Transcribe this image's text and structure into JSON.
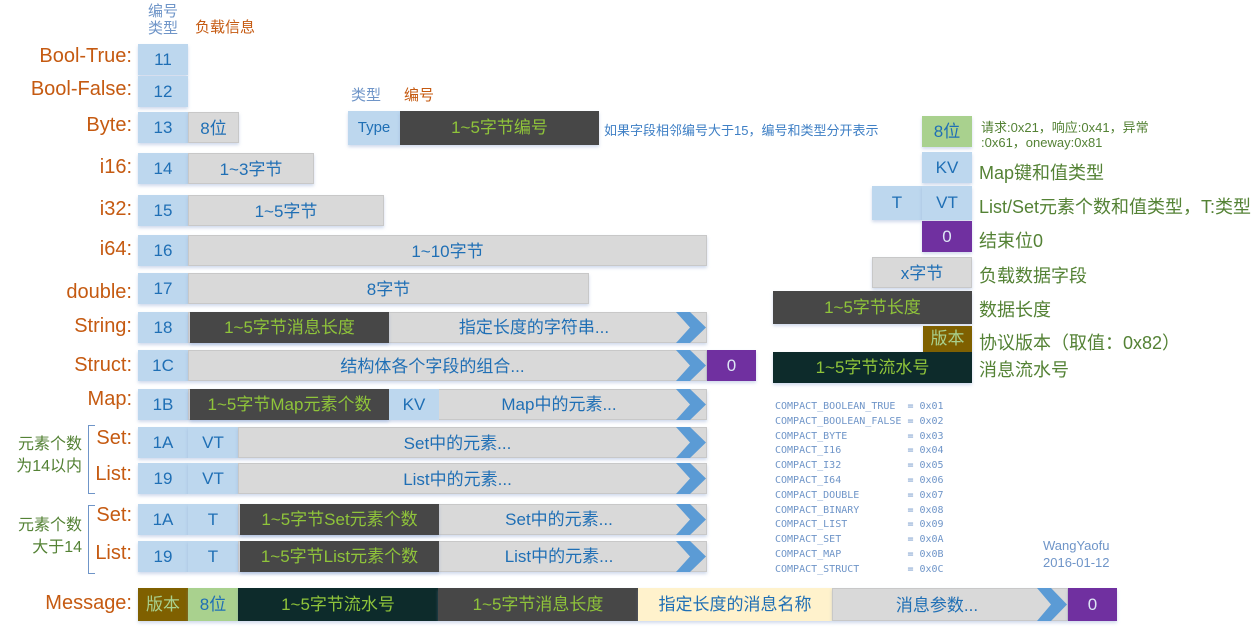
{
  "header": {
    "code_type": "编号\n类型",
    "code_type_l1": "编号",
    "code_type_l2": "类型",
    "payload": "负载信息"
  },
  "rows": [
    {
      "label": "Bool-True:",
      "code": "11"
    },
    {
      "label": "Bool-False:",
      "code": "12"
    },
    {
      "label": "Byte:",
      "code": "13",
      "payload": "8位"
    },
    {
      "label": "i16:",
      "code": "14",
      "payload": "1~3字节"
    },
    {
      "label": "i32:",
      "code": "15",
      "payload": "1~5字节"
    },
    {
      "label": "i64:",
      "code": "16",
      "payload": "1~10字节"
    },
    {
      "label": "double:",
      "code": "17",
      "payload": "8字节"
    },
    {
      "label": "String:",
      "code": "18",
      "len": "1~5字节消息长度",
      "payload": "指定长度的字符串..."
    },
    {
      "label": "Struct:",
      "code": "1C",
      "payload": "结构体各个字段的组合...",
      "end": "0"
    },
    {
      "label": "Map:",
      "code": "1B",
      "len": "1~5字节Map元素个数",
      "kv": "KV",
      "payload": "Map中的元素..."
    },
    {
      "label": "Set:",
      "code": "1A",
      "vt": "VT",
      "payload": "Set中的元素..."
    },
    {
      "label": "List:",
      "code": "19",
      "vt": "VT",
      "payload": "List中的元素..."
    },
    {
      "label": "Set:",
      "code": "1A",
      "t": "T",
      "len": "1~5字节Set元素个数",
      "payload": "Set中的元素..."
    },
    {
      "label": "List:",
      "code": "19",
      "t": "T",
      "len": "1~5字节List元素个数",
      "payload": "List中的元素..."
    }
  ],
  "groups": {
    "small_l1": "元素个数",
    "small_l2": "为14以内",
    "large_l1": "元素个数",
    "large_l2": "大于14"
  },
  "field_header": {
    "type_label": "类型",
    "id_label": "编号",
    "type_box": "Type",
    "id_box": "1~5字节编号",
    "note": "如果字段相邻编号大于15，编号和类型分开表示"
  },
  "legend": [
    {
      "box": "8位",
      "text_l1": "请求:0x21，响应:0x41，异常",
      "text_l2": ":0x61，oneway:0x81"
    },
    {
      "box": "KV",
      "text": "Map键和值类型"
    },
    {
      "box_t": "T",
      "box": "VT",
      "text": "List/Set元素个数和值类型，T:类型"
    },
    {
      "box": "0",
      "text": "结束位0"
    },
    {
      "box": "x字节",
      "text": "负载数据字段"
    },
    {
      "box": "1~5字节长度",
      "text": "数据长度"
    },
    {
      "box": "版本",
      "text": "协议版本（取值：0x82）"
    },
    {
      "box": "1~5字节流水号",
      "text": "消息流水号"
    }
  ],
  "constants": [
    {
      "name": "COMPACT_BOOLEAN_TRUE",
      "value": "0x01"
    },
    {
      "name": "COMPACT_BOOLEAN_FALSE",
      "value": "0x02"
    },
    {
      "name": "COMPACT_BYTE",
      "value": "0x03"
    },
    {
      "name": "COMPACT_I16",
      "value": "0x04"
    },
    {
      "name": "COMPACT_I32",
      "value": "0x05"
    },
    {
      "name": "COMPACT_I64",
      "value": "0x06"
    },
    {
      "name": "COMPACT_DOUBLE",
      "value": "0x07"
    },
    {
      "name": "COMPACT_BINARY",
      "value": "0x08"
    },
    {
      "name": "COMPACT_LIST",
      "value": "0x09"
    },
    {
      "name": "COMPACT_SET",
      "value": "0x0A"
    },
    {
      "name": "COMPACT_MAP",
      "value": "0x0B"
    },
    {
      "name": "COMPACT_STRUCT",
      "value": "0x0C"
    }
  ],
  "author": {
    "name": "WangYaofu",
    "date": "2016-01-12"
  },
  "message": {
    "label": "Message:",
    "version": "版本",
    "bits": "8位",
    "seq": "1~5字节流水号",
    "len": "1~5字节消息长度",
    "name": "指定长度的消息名称",
    "params": "消息参数...",
    "end": "0"
  },
  "colors": {
    "label": "#c55a11",
    "code_bg": "#bdd7ee",
    "payload_bg": "#d9d9d9",
    "dark_bg": "#474747",
    "teal_bg": "#0d2b2b",
    "purple": "#7030a0",
    "olive": "#7f6000",
    "light_green": "#a9d18e",
    "cream": "#fff2cc",
    "accent_blue": "#1f6fb5",
    "green_text": "#8fc43a",
    "legend_green": "#548235"
  }
}
